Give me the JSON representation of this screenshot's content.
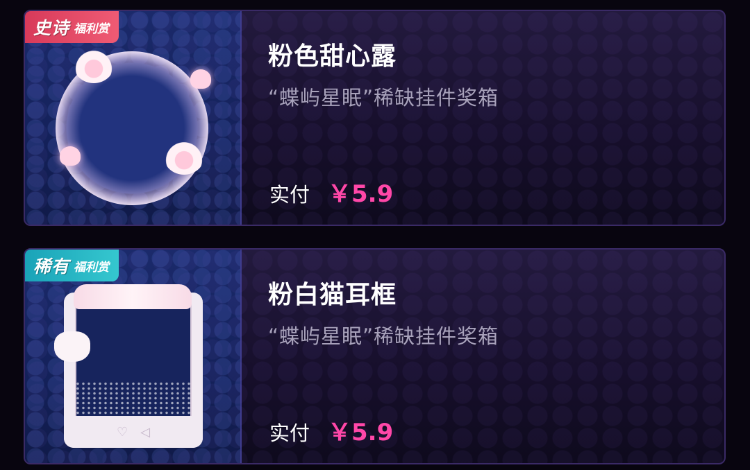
{
  "items": [
    {
      "badge_main": "史诗",
      "badge_sub": "福利赏",
      "badge_color": "#e04866",
      "title": "粉色甜心露",
      "subtitle": "“蝶屿星眠”稀缺挂件奖箱",
      "price_label": "实付",
      "price": "￥5.9"
    },
    {
      "badge_main": "稀有",
      "badge_sub": "福利赏",
      "badge_color": "#25b5c2",
      "title": "粉白猫耳框",
      "subtitle": "“蝶屿星眠”稀缺挂件奖箱",
      "price_label": "实付",
      "price": "￥5.9"
    }
  ],
  "colors": {
    "price": "#ff47a8",
    "card_border": "#3a2a66",
    "background": "#08050f"
  }
}
